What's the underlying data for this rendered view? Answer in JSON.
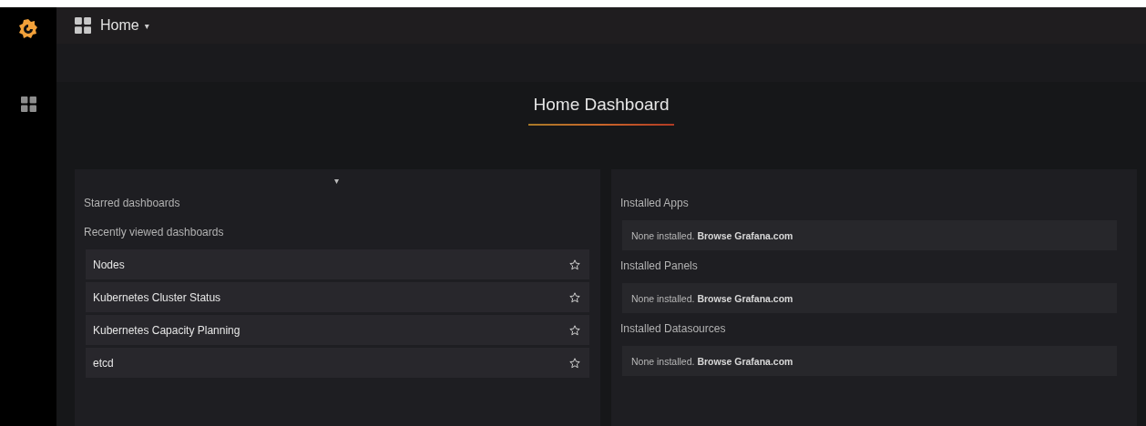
{
  "topbar": {
    "title": "Home",
    "caret": "▾"
  },
  "header": {
    "title": "Home Dashboard"
  },
  "left_panel": {
    "collapse": "▾",
    "starred_heading": "Starred dashboards",
    "recent_heading": "Recently viewed dashboards",
    "recent": [
      {
        "name": "Nodes",
        "starred": false
      },
      {
        "name": "Kubernetes Cluster Status",
        "starred": false
      },
      {
        "name": "Kubernetes Capacity Planning",
        "starred": false
      },
      {
        "name": "etcd",
        "starred": false
      }
    ]
  },
  "right_panel": {
    "sections": [
      {
        "heading": "Installed Apps",
        "message": "None installed. **Browse Grafana.com**"
      },
      {
        "heading": "Installed Panels",
        "message": "None installed. **Browse Grafana.com**"
      },
      {
        "heading": "Installed Datasources",
        "message": "None installed. **Browse Grafana.com**"
      }
    ]
  }
}
